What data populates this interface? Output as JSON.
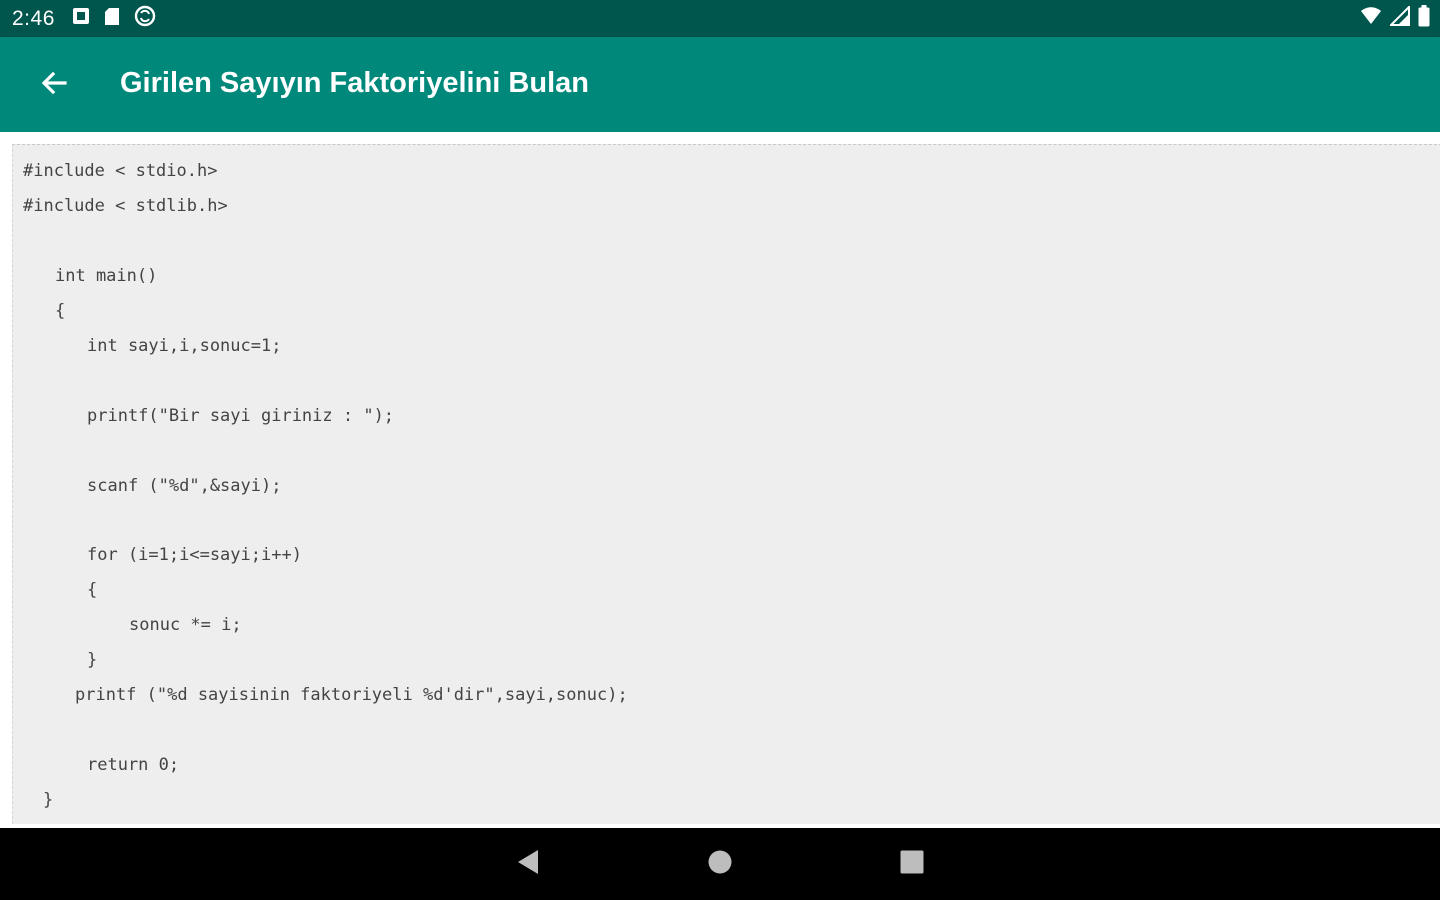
{
  "status_bar": {
    "time": "2:46",
    "left_icons": [
      "notification-icon",
      "sd-card-icon",
      "sync-icon"
    ],
    "right_icons": [
      "wifi-icon",
      "signal-icon",
      "battery-icon"
    ]
  },
  "app_bar": {
    "back_icon": "arrow-left-icon",
    "title": "Girilen Sayıyın Faktoriyelini Bulan"
  },
  "code": {
    "lines": [
      "#include < stdio.h>",
      "#include < stdlib.h>",
      "int main()",
      "{",
      "int sayi,i,sonuc=1;",
      "printf(\"Bir sayi giriniz : \");",
      "scanf (\"%d\",&sayi);",
      "for (i=1;i<=sayi;i++)",
      "{",
      "sonuc *= i;",
      "}",
      "printf (\"%d sayisinin faktoriyeli %d'dir\",sayi,sonuc);",
      "return 0;",
      "}"
    ]
  },
  "nav_bar": {
    "buttons": [
      "back-triangle-icon",
      "home-circle-icon",
      "recents-square-icon"
    ]
  },
  "colors": {
    "status_bar": "#00564d",
    "app_bar": "#00897b",
    "code_background": "#eeeeee",
    "code_text": "#444444",
    "nav_bar": "#000000"
  }
}
